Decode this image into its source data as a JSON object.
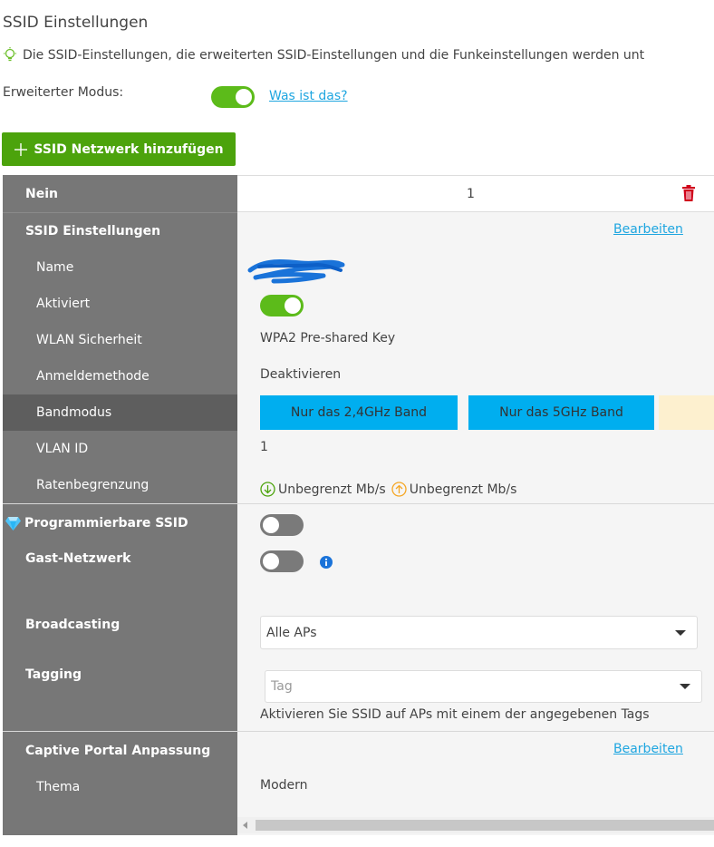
{
  "page": {
    "title": "SSID Einstellungen",
    "info": "Die SSID-Einstellungen, die erweiterten SSID-Einstellungen und die Funkeinstellungen werden unt",
    "advanced_mode_label": "Erweiterter Modus:",
    "advanced_mode_on": true,
    "help_link": "Was ist das?",
    "add_button": "SSID Netzwerk hinzufügen"
  },
  "ssid": {
    "nein_label": "Nein",
    "nein_value": "1",
    "section_label": "SSID Einstellungen",
    "edit_link": "Bearbeiten",
    "name_label": "Name",
    "activated_label": "Aktiviert",
    "activated_on": true,
    "security_label": "WLAN Sicherheit",
    "security_value": "WPA2 Pre-shared Key",
    "login_label": "Anmeldemethode",
    "login_value": "Deaktivieren",
    "band_label": "Bandmodus",
    "band_options": [
      "Nur das 2,4GHz Band",
      "Nur das 5GHz Band"
    ],
    "vlan_label": "VLAN ID",
    "vlan_value": "1",
    "rate_label": "Ratenbegrenzung",
    "rate_down": "Unbegrenzt Mb/s",
    "rate_up": "Unbegrenzt Mb/s"
  },
  "extra": {
    "programmable_label": "Programmierbare SSID",
    "programmable_on": false,
    "guest_label": "Gast-Netzwerk",
    "guest_on": false,
    "broadcast_label": "Broadcasting",
    "broadcast_value": "Alle APs",
    "tagging_label": "Tagging",
    "tag_placeholder": "Tag",
    "tagging_hint": "Aktivieren Sie SSID auf APs mit einem der angegebenen Tags"
  },
  "captive": {
    "label": "Captive Portal Anpassung",
    "edit_link": "Bearbeiten",
    "theme_label": "Thema",
    "theme_value": "Modern"
  },
  "colors": {
    "accent_green": "#4ca30c",
    "toggle_on": "#5cbb1a",
    "band_selected": "#00aeef",
    "link": "#1fa6e0",
    "delete": "#d0021b"
  }
}
